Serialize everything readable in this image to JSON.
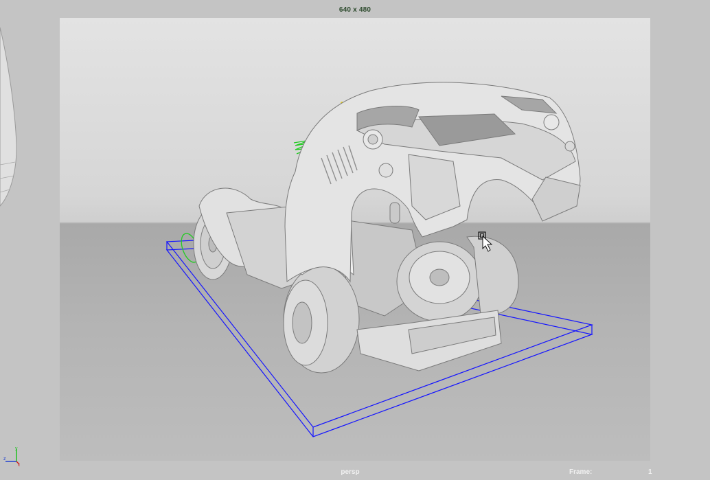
{
  "viewport": {
    "resolution_label": "640 x 480",
    "camera_name": "persp",
    "frame_label": "Frame:",
    "frame_value": "1"
  },
  "gizmo": {
    "axes": [
      "x",
      "y",
      "z"
    ],
    "colors": {
      "x": "#d02020",
      "y": "#20c020",
      "z": "#2040d0"
    }
  },
  "colors": {
    "background": "#c4c4c4",
    "label_green": "#2d4a2d",
    "bounding_box": "#1414ff",
    "curve_green": "#22cc22",
    "model_gray": "#dcdcdc"
  },
  "icons": {
    "cursor": "cursor-icon",
    "axis": "axis-gizmo-icon"
  }
}
